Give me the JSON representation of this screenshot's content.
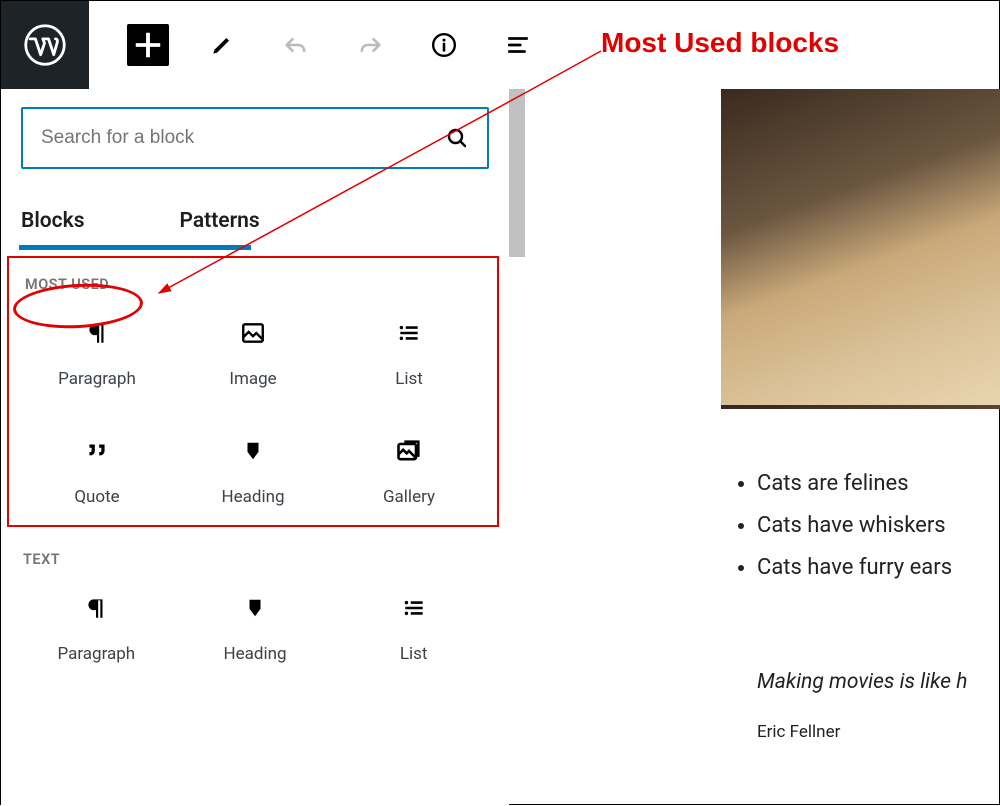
{
  "toolbar": {
    "add_label": "Add block",
    "edit_label": "Tools",
    "undo_label": "Undo",
    "redo_label": "Redo",
    "info_label": "Details",
    "outline_label": "Outline"
  },
  "panel": {
    "search_placeholder": "Search for a block",
    "tabs": {
      "blocks": "Blocks",
      "patterns": "Patterns"
    },
    "sections": {
      "most_used": {
        "title": "MOST USED",
        "items": [
          {
            "label": "Paragraph",
            "icon": "paragraph"
          },
          {
            "label": "Image",
            "icon": "image"
          },
          {
            "label": "List",
            "icon": "list"
          },
          {
            "label": "Quote",
            "icon": "quote"
          },
          {
            "label": "Heading",
            "icon": "heading"
          },
          {
            "label": "Gallery",
            "icon": "gallery"
          }
        ]
      },
      "text": {
        "title": "TEXT",
        "items": [
          {
            "label": "Paragraph",
            "icon": "paragraph"
          },
          {
            "label": "Heading",
            "icon": "heading"
          },
          {
            "label": "List",
            "icon": "list"
          }
        ]
      }
    }
  },
  "annotation": {
    "label": "Most Used blocks"
  },
  "content": {
    "list": [
      "Cats are felines",
      "Cats have whiskers",
      "Cats have furry ears"
    ],
    "quote": {
      "text": "Making movies is like h",
      "cite": "Eric Fellner"
    }
  }
}
